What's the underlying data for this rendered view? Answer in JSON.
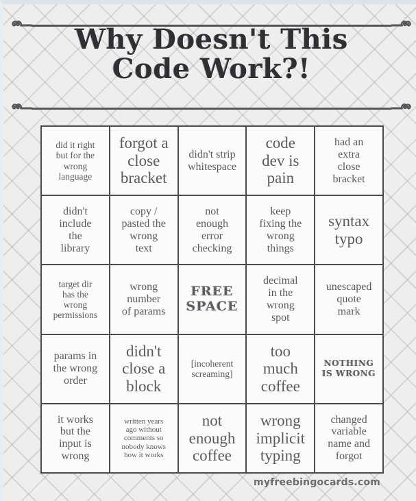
{
  "header": {
    "title_line_1": "Why Doesn't This",
    "title_line_2": "Code Work?!"
  },
  "footer": {
    "site": "myfreebingocards.com"
  },
  "grid": {
    "rows": 5,
    "columns": 5,
    "cells": [
      {
        "text": "did it right\nbut for the\nwrong\nlanguage",
        "size": "sm",
        "style": "plain"
      },
      {
        "text": "forgot a\nclose\nbracket",
        "size": "xl",
        "style": "plain"
      },
      {
        "text": "didn't strip\nwhitespace",
        "size": "md",
        "style": "plain"
      },
      {
        "text": "code\ndev is\npain",
        "size": "xl",
        "style": "plain"
      },
      {
        "text": "had an\nextra\nclose\nbracket",
        "size": "md",
        "style": "plain"
      },
      {
        "text": "didn't\ninclude\nthe\nlibrary",
        "size": "md",
        "style": "plain"
      },
      {
        "text": "copy /\npasted the\nwrong\ntext",
        "size": "md",
        "style": "plain"
      },
      {
        "text": "not\nenough\nerror\nchecking",
        "size": "md",
        "style": "plain"
      },
      {
        "text": "keep\nfixing the\nwrong\nthings",
        "size": "md",
        "style": "plain"
      },
      {
        "text": "syntax\ntypo",
        "size": "xl",
        "style": "plain"
      },
      {
        "text": "target dir\nhas the\nwrong\npermissions",
        "size": "sm",
        "style": "plain"
      },
      {
        "text": "wrong\nnumber\nof params",
        "size": "md",
        "style": "plain"
      },
      {
        "text": "FREE\nSPACE",
        "size": "lg",
        "style": "fancy-free"
      },
      {
        "text": "decimal\nin the\nwrong\nspot",
        "size": "md",
        "style": "plain"
      },
      {
        "text": "unescaped\nquote\nmark",
        "size": "md",
        "style": "plain"
      },
      {
        "text": "params in\nthe wrong\norder",
        "size": "md",
        "style": "plain"
      },
      {
        "text": "didn't\nclose a\nblock",
        "size": "xl",
        "style": "plain"
      },
      {
        "text": "[incoherent\nscreaming]",
        "size": "sm",
        "style": "plain"
      },
      {
        "text": "too\nmuch\ncoffee",
        "size": "xl",
        "style": "plain"
      },
      {
        "text": "NOTHING\nIS WRONG",
        "size": "sm",
        "style": "fancy-nothing"
      },
      {
        "text": "it works\nbut the\ninput is\nwrong",
        "size": "md",
        "style": "plain"
      },
      {
        "text": "written years\nago without\ncomments so\nnobody knows\nhow it works",
        "size": "xs",
        "style": "plain"
      },
      {
        "text": "not\nenough\ncoffee",
        "size": "xl",
        "style": "plain"
      },
      {
        "text": "wrong\nimplicit\ntyping",
        "size": "xl",
        "style": "plain"
      },
      {
        "text": "changed\nvariable\nname and\nforgot",
        "size": "md",
        "style": "plain"
      }
    ]
  },
  "colors": {
    "background": "#eeeeee",
    "grid_line": "#4a4b4f",
    "cell_background": "#fbfbfb",
    "text": "#5a5b5e",
    "title_text": "#2f3033",
    "footer_text": "#6b6c70"
  }
}
